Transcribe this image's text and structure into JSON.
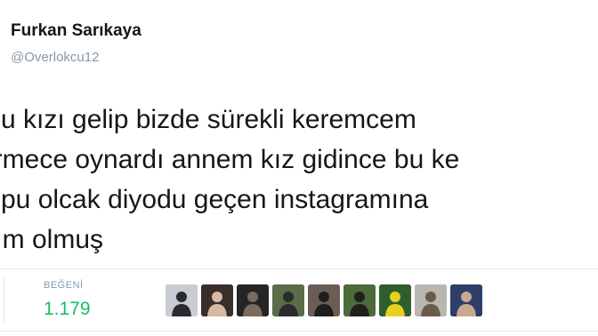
{
  "author": {
    "name": "Furkan Sarıkaya",
    "handle": "@Overlokcu12"
  },
  "tweet": {
    "lines": [
      "şu kızı gelip bizde sürekli keremcem",
      "irmece oynardı annem kız gidince bu ke",
      "spu olcak diyodu geçen instagramına",
      "tım olmuş"
    ]
  },
  "stats": {
    "likes_label": "BEĞENİ",
    "likes_count": "1.179"
  },
  "colors": {
    "likes_count": "#17bf63",
    "muted": "#8899a6",
    "text": "#14171a",
    "divider": "#e1e8ed"
  },
  "liker_avatars": [
    {
      "icon": "person-silhouette-icon",
      "bg": "#c9ccd3",
      "fg": "#2a2a30"
    },
    {
      "icon": "person-photo-icon",
      "bg": "#3a2e2a",
      "fg": "#d8b8a0"
    },
    {
      "icon": "person-photo-icon",
      "bg": "#252525",
      "fg": "#7a6a60"
    },
    {
      "icon": "group-photo-icon",
      "bg": "#5c6b4a",
      "fg": "#2b2b2b"
    },
    {
      "icon": "person-photo-icon",
      "bg": "#6a5d55",
      "fg": "#1e1e1e"
    },
    {
      "icon": "person-photo-icon",
      "bg": "#4d6a3a",
      "fg": "#1f1f1f"
    },
    {
      "icon": "team-photo-icon",
      "bg": "#2f5e2f",
      "fg": "#e8d020"
    },
    {
      "icon": "person-photo-icon",
      "bg": "#b7b7b0",
      "fg": "#6b5a4a"
    },
    {
      "icon": "person-photo-icon",
      "bg": "#2e3d6a",
      "fg": "#c9a890"
    }
  ]
}
